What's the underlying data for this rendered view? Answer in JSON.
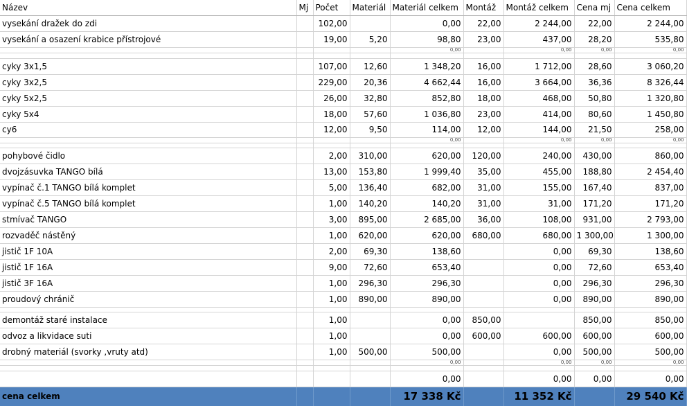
{
  "columns": [
    "Název",
    "Mj",
    "Počet",
    "Materiál",
    "Materiál celkem",
    "Montáž",
    "Montáž celkem",
    "Cena mj",
    "Cena celkem"
  ],
  "rows": [
    {
      "name": "vysekání dražek  do zdi",
      "mj": "",
      "pocet": "102,00",
      "material": "",
      "material_celkem": "0,00",
      "montaz": "22,00",
      "montaz_celkem": "2 244,00",
      "cena_mj": "22,00",
      "cena_celkem": "2 244,00"
    },
    {
      "name": "vysekání a osazení krabice přístrojové",
      "mj": "",
      "pocet": "19,00",
      "material": "5,20",
      "material_celkem": "98,80",
      "montaz": "23,00",
      "montaz_celkem": "437,00",
      "cena_mj": "28,20",
      "cena_celkem": "535,80"
    },
    {
      "name": "cyky 3x1,5",
      "mj": "",
      "pocet": "107,00",
      "material": "12,60",
      "material_celkem": "1 348,20",
      "montaz": "16,00",
      "montaz_celkem": "1 712,00",
      "cena_mj": "28,60",
      "cena_celkem": "3 060,20"
    },
    {
      "name": "cyky 3x2,5",
      "mj": "",
      "pocet": "229,00",
      "material": "20,36",
      "material_celkem": "4 662,44",
      "montaz": "16,00",
      "montaz_celkem": "3 664,00",
      "cena_mj": "36,36",
      "cena_celkem": "8 326,44"
    },
    {
      "name": "cyky 5x2,5",
      "mj": "",
      "pocet": "26,00",
      "material": "32,80",
      "material_celkem": "852,80",
      "montaz": "18,00",
      "montaz_celkem": "468,00",
      "cena_mj": "50,80",
      "cena_celkem": "1 320,80"
    },
    {
      "name": "cyky 5x4",
      "mj": "",
      "pocet": "18,00",
      "material": "57,60",
      "material_celkem": "1 036,80",
      "montaz": "23,00",
      "montaz_celkem": "414,00",
      "cena_mj": "80,60",
      "cena_celkem": "1 450,80"
    },
    {
      "name": "cy6",
      "mj": "",
      "pocet": "12,00",
      "material": "9,50",
      "material_celkem": "114,00",
      "montaz": "12,00",
      "montaz_celkem": "144,00",
      "cena_mj": "21,50",
      "cena_celkem": "258,00"
    },
    {
      "name": "pohybové čidlo",
      "mj": "",
      "pocet": "2,00",
      "material": "310,00",
      "material_celkem": "620,00",
      "montaz": "120,00",
      "montaz_celkem": "240,00",
      "cena_mj": "430,00",
      "cena_celkem": "860,00"
    },
    {
      "name": "dvojzásuvka TANGO bílá",
      "mj": "",
      "pocet": "13,00",
      "material": "153,80",
      "material_celkem": "1 999,40",
      "montaz": "35,00",
      "montaz_celkem": "455,00",
      "cena_mj": "188,80",
      "cena_celkem": "2 454,40"
    },
    {
      "name": "vypínač č.1 TANGO bílá komplet",
      "mj": "",
      "pocet": "5,00",
      "material": "136,40",
      "material_celkem": "682,00",
      "montaz": "31,00",
      "montaz_celkem": "155,00",
      "cena_mj": "167,40",
      "cena_celkem": "837,00"
    },
    {
      "name": "vypínač č.5 TANGO bílá komplet",
      "mj": "",
      "pocet": "1,00",
      "material": "140,20",
      "material_celkem": "140,20",
      "montaz": "31,00",
      "montaz_celkem": "31,00",
      "cena_mj": "171,20",
      "cena_celkem": "171,20"
    },
    {
      "name": "stmívač TANGO",
      "mj": "",
      "pocet": "3,00",
      "material": "895,00",
      "material_celkem": "2 685,00",
      "montaz": "36,00",
      "montaz_celkem": "108,00",
      "cena_mj": "931,00",
      "cena_celkem": "2 793,00"
    },
    {
      "name": "rozvaděč nástěný",
      "mj": "",
      "pocet": "1,00",
      "material": "620,00",
      "material_celkem": "620,00",
      "montaz": "680,00",
      "montaz_celkem": "680,00",
      "cena_mj": "1 300,00",
      "cena_celkem": "1 300,00"
    },
    {
      "name": "jistič 1F 10A",
      "mj": "",
      "pocet": "2,00",
      "material": "69,30",
      "material_celkem": "138,60",
      "montaz": "",
      "montaz_celkem": "0,00",
      "cena_mj": "69,30",
      "cena_celkem": "138,60"
    },
    {
      "name": "jistič 1F 16A",
      "mj": "",
      "pocet": "9,00",
      "material": "72,60",
      "material_celkem": "653,40",
      "montaz": "",
      "montaz_celkem": "0,00",
      "cena_mj": "72,60",
      "cena_celkem": "653,40"
    },
    {
      "name": "jistič 3F 16A",
      "mj": "",
      "pocet": "1,00",
      "material": "296,30",
      "material_celkem": "296,30",
      "montaz": "",
      "montaz_celkem": "0,00",
      "cena_mj": "296,30",
      "cena_celkem": "296,30"
    },
    {
      "name": "proudový chránič",
      "mj": "",
      "pocet": "1,00",
      "material": "890,00",
      "material_celkem": "890,00",
      "montaz": "",
      "montaz_celkem": "0,00",
      "cena_mj": "890,00",
      "cena_celkem": "890,00"
    },
    {
      "name": "demontáž staré instalace",
      "mj": "",
      "pocet": "1,00",
      "material": "",
      "material_celkem": "0,00",
      "montaz": "850,00",
      "montaz_celkem": "",
      "cena_mj": "850,00",
      "cena_celkem": "850,00"
    },
    {
      "name": "odvoz a likvidace suti",
      "mj": "",
      "pocet": "1,00",
      "material": "",
      "material_celkem": "0,00",
      "montaz": "600,00",
      "montaz_celkem": "600,00",
      "cena_mj": "600,00",
      "cena_celkem": "600,00"
    },
    {
      "name": "drobný materiál (svorky ,vruty atd)",
      "mj": "",
      "pocet": "1,00",
      "material": "500,00",
      "material_celkem": "500,00",
      "montaz": "",
      "montaz_celkem": "0,00",
      "cena_mj": "500,00",
      "cena_celkem": "500,00"
    }
  ],
  "blank_row": {
    "material_celkem": "0,00",
    "montaz_celkem": "0,00",
    "cena_mj": "0,00",
    "cena_celkem": "0,00"
  },
  "cut_value": "0,00",
  "total": {
    "label": "cena celkem",
    "material_celkem": "17 338 Kč",
    "montaz_celkem": "11 352 Kč",
    "cena_celkem": "29 540 Kč"
  },
  "colors": {
    "total_fill": "#4f81bd",
    "grid": "#d4d4d4"
  }
}
